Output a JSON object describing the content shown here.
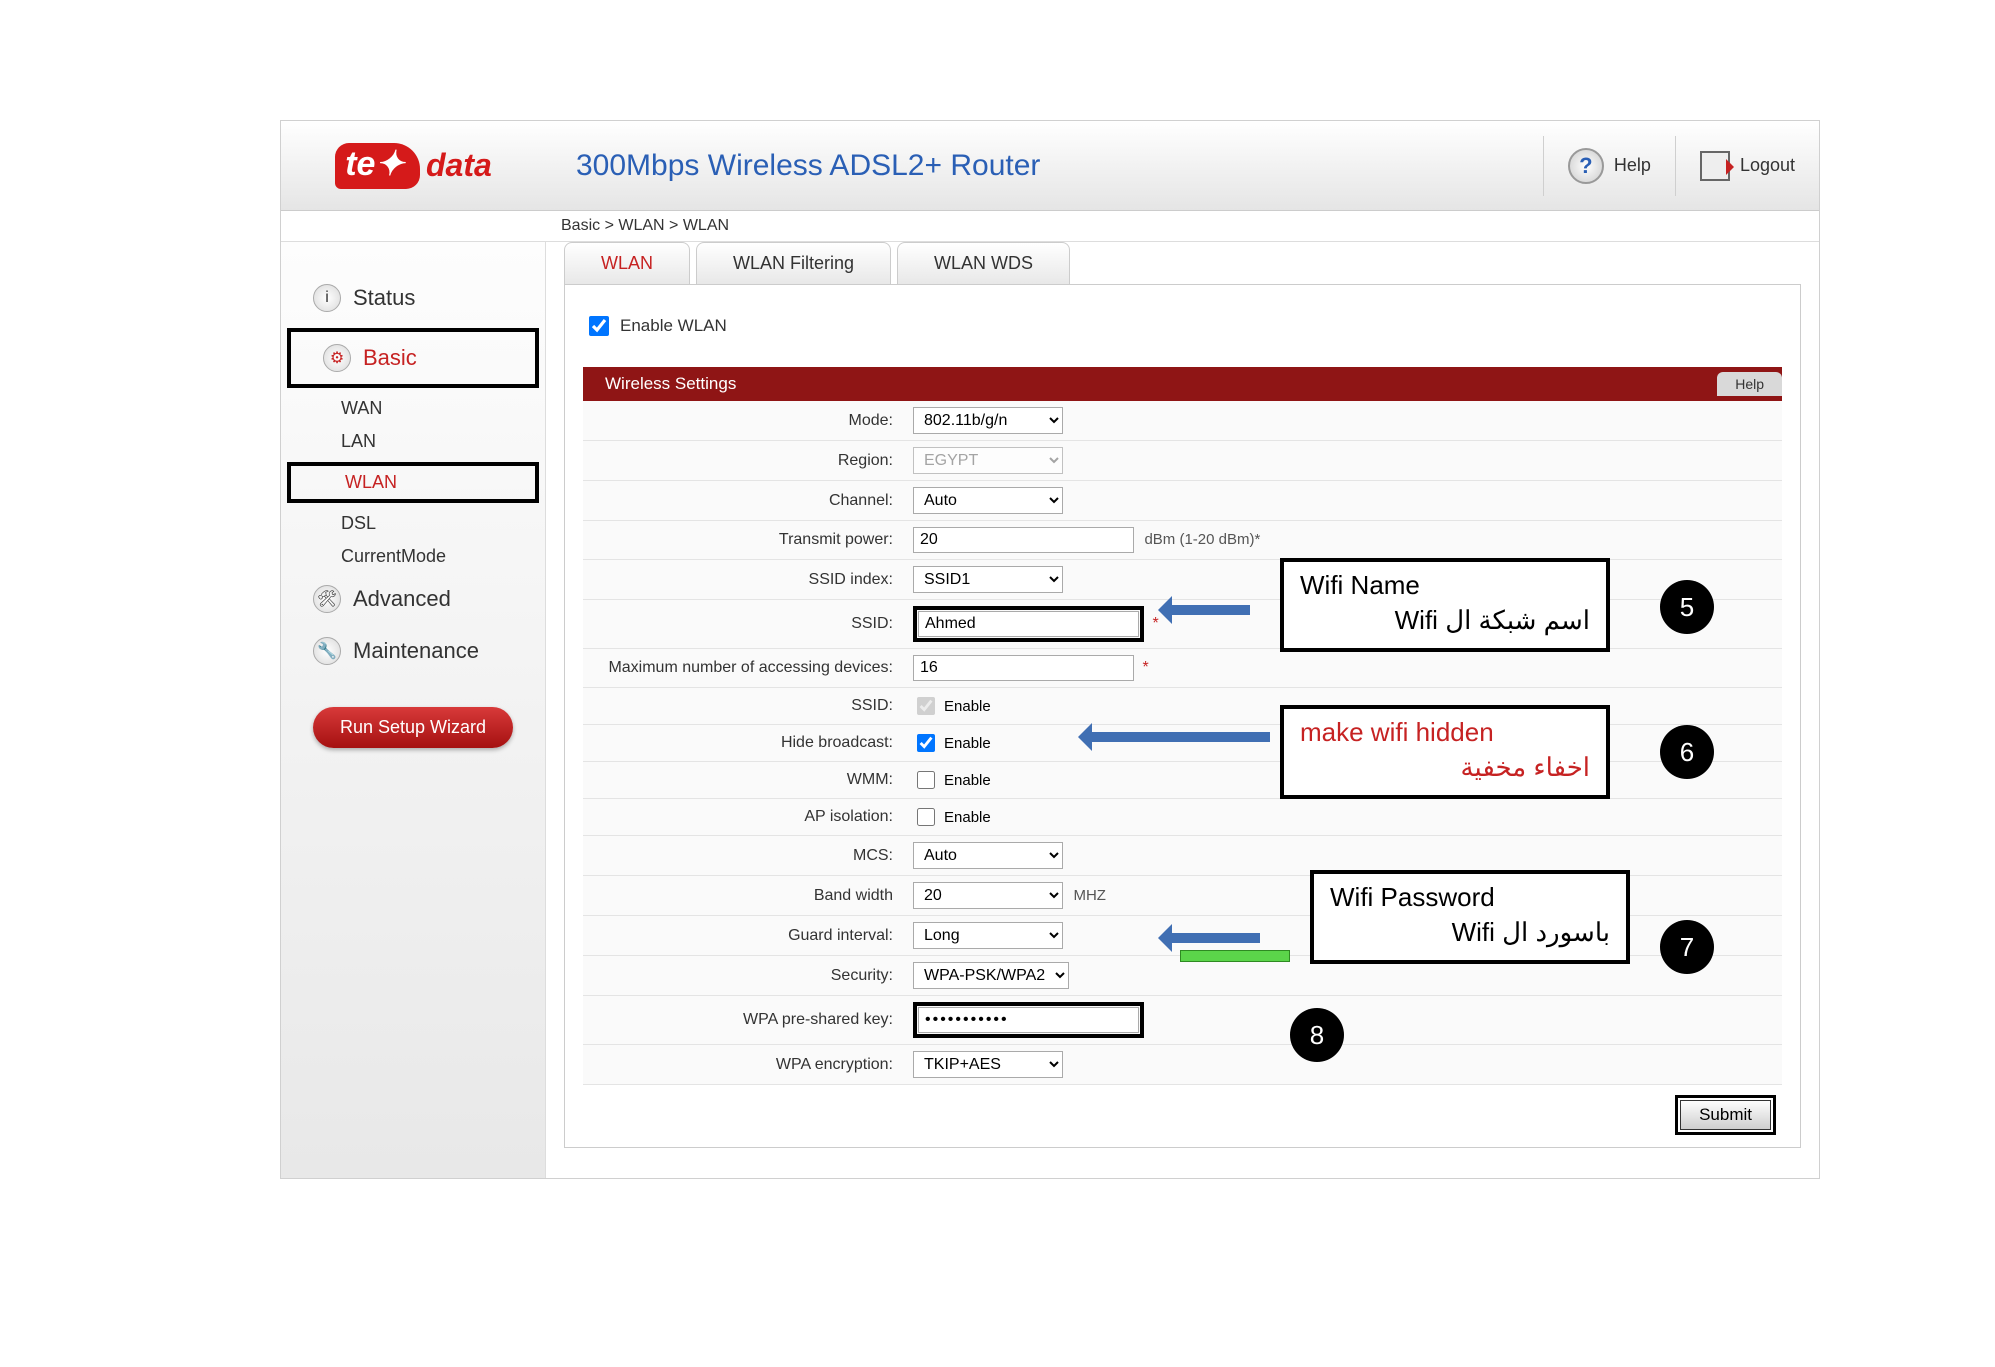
{
  "header": {
    "logo_mark": "te✦",
    "logo_text": "data",
    "title": "300Mbps Wireless ADSL2+ Router",
    "help": "Help",
    "logout": "Logout"
  },
  "breadcrumb": "Basic > WLAN > WLAN",
  "nav": {
    "status": "Status",
    "basic": "Basic",
    "sub": {
      "wan": "WAN",
      "lan": "LAN",
      "wlan": "WLAN",
      "dsl": "DSL",
      "mode": "CurrentMode"
    },
    "advanced": "Advanced",
    "maintenance": "Maintenance",
    "wizard": "Run Setup Wizard"
  },
  "tabs": {
    "wlan": "WLAN",
    "filtering": "WLAN Filtering",
    "wds": "WLAN WDS"
  },
  "enable_wlan_label": "Enable WLAN",
  "section_title": "Wireless Settings",
  "section_help": "Help",
  "rows": {
    "mode": {
      "label": "Mode:",
      "value": "802.11b/g/n"
    },
    "region": {
      "label": "Region:",
      "value": "EGYPT"
    },
    "channel": {
      "label": "Channel:",
      "value": "Auto"
    },
    "txpower": {
      "label": "Transmit power:",
      "value": "20",
      "hint": "dBm (1-20 dBm)*"
    },
    "ssid_index": {
      "label": "SSID index:",
      "value": "SSID1"
    },
    "ssid": {
      "label": "SSID:",
      "value": "Ahmed"
    },
    "max_dev": {
      "label": "Maximum number of accessing devices:",
      "value": "16"
    },
    "ssid_enable": {
      "label": "SSID:",
      "opt": "Enable"
    },
    "hide": {
      "label": "Hide broadcast:",
      "opt": "Enable"
    },
    "wmm": {
      "label": "WMM:",
      "opt": "Enable"
    },
    "ap_iso": {
      "label": "AP isolation:",
      "opt": "Enable"
    },
    "mcs": {
      "label": "MCS:",
      "value": "Auto"
    },
    "bw": {
      "label": "Band width",
      "value": "20",
      "hint": "MHZ"
    },
    "gi": {
      "label": "Guard interval:",
      "value": "Long"
    },
    "security": {
      "label": "Security:",
      "value": "WPA-PSK/WPA2"
    },
    "psk": {
      "label": "WPA pre-shared key:",
      "value": "●●●●●●●●●●●"
    },
    "enc": {
      "label": "WPA encryption:",
      "value": "TKIP+AES"
    }
  },
  "submit": "Submit",
  "annotations": {
    "name": {
      "en": "Wifi Name",
      "ar": "اسم شبكة ال   Wifi"
    },
    "hide": {
      "en": "make wifi hidden",
      "ar": "اخفاء مخفية"
    },
    "pwd": {
      "en": "Wifi Password",
      "ar": "باسورد ال   Wifi"
    },
    "step5": "5",
    "step6": "6",
    "step7": "7",
    "step8": "8"
  }
}
